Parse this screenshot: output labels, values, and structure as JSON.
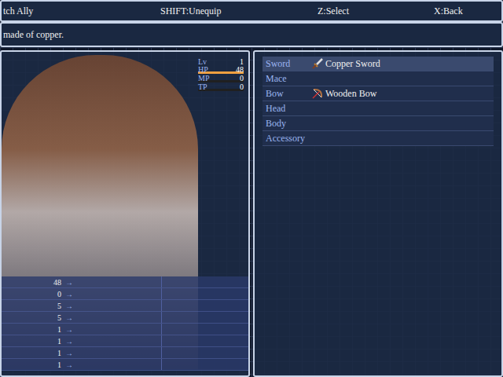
{
  "help_bar": {
    "keys": [
      "tch Ally",
      "SHIFT:Unequip",
      "Z:Select",
      "X:Back"
    ]
  },
  "help_text": "made of copper.",
  "actor": {
    "level_label": "Lv",
    "level": "1",
    "gauges": [
      {
        "label": "HP",
        "value": "48",
        "level": 1,
        "color": "#f0a040"
      },
      {
        "label": "MP",
        "value": "0",
        "level": 0,
        "color": "#4080f0"
      },
      {
        "label": "TP",
        "value": "0",
        "level": 0,
        "color": "#40c060"
      }
    ]
  },
  "params": [
    {
      "value": "48",
      "arrow": "→"
    },
    {
      "value": "0",
      "arrow": "→"
    },
    {
      "value": "5",
      "arrow": "→"
    },
    {
      "value": "5",
      "arrow": "→"
    },
    {
      "value": "1",
      "arrow": "→"
    },
    {
      "value": "1",
      "arrow": "→"
    },
    {
      "value": "1",
      "arrow": "→"
    },
    {
      "value": "1",
      "arrow": "→"
    }
  ],
  "slots": [
    {
      "label": "Sword",
      "item": "Copper Sword",
      "kind": "sword",
      "selected": true
    },
    {
      "label": "Mace",
      "item": "",
      "kind": "empty",
      "selected": false
    },
    {
      "label": "Bow",
      "item": "Wooden Bow",
      "kind": "bow",
      "selected": false
    },
    {
      "label": "Head",
      "item": "",
      "kind": "empty",
      "selected": false
    },
    {
      "label": "Body",
      "item": "",
      "kind": "empty",
      "selected": false
    },
    {
      "label": "Accessory",
      "item": "",
      "kind": "empty",
      "selected": false
    }
  ]
}
